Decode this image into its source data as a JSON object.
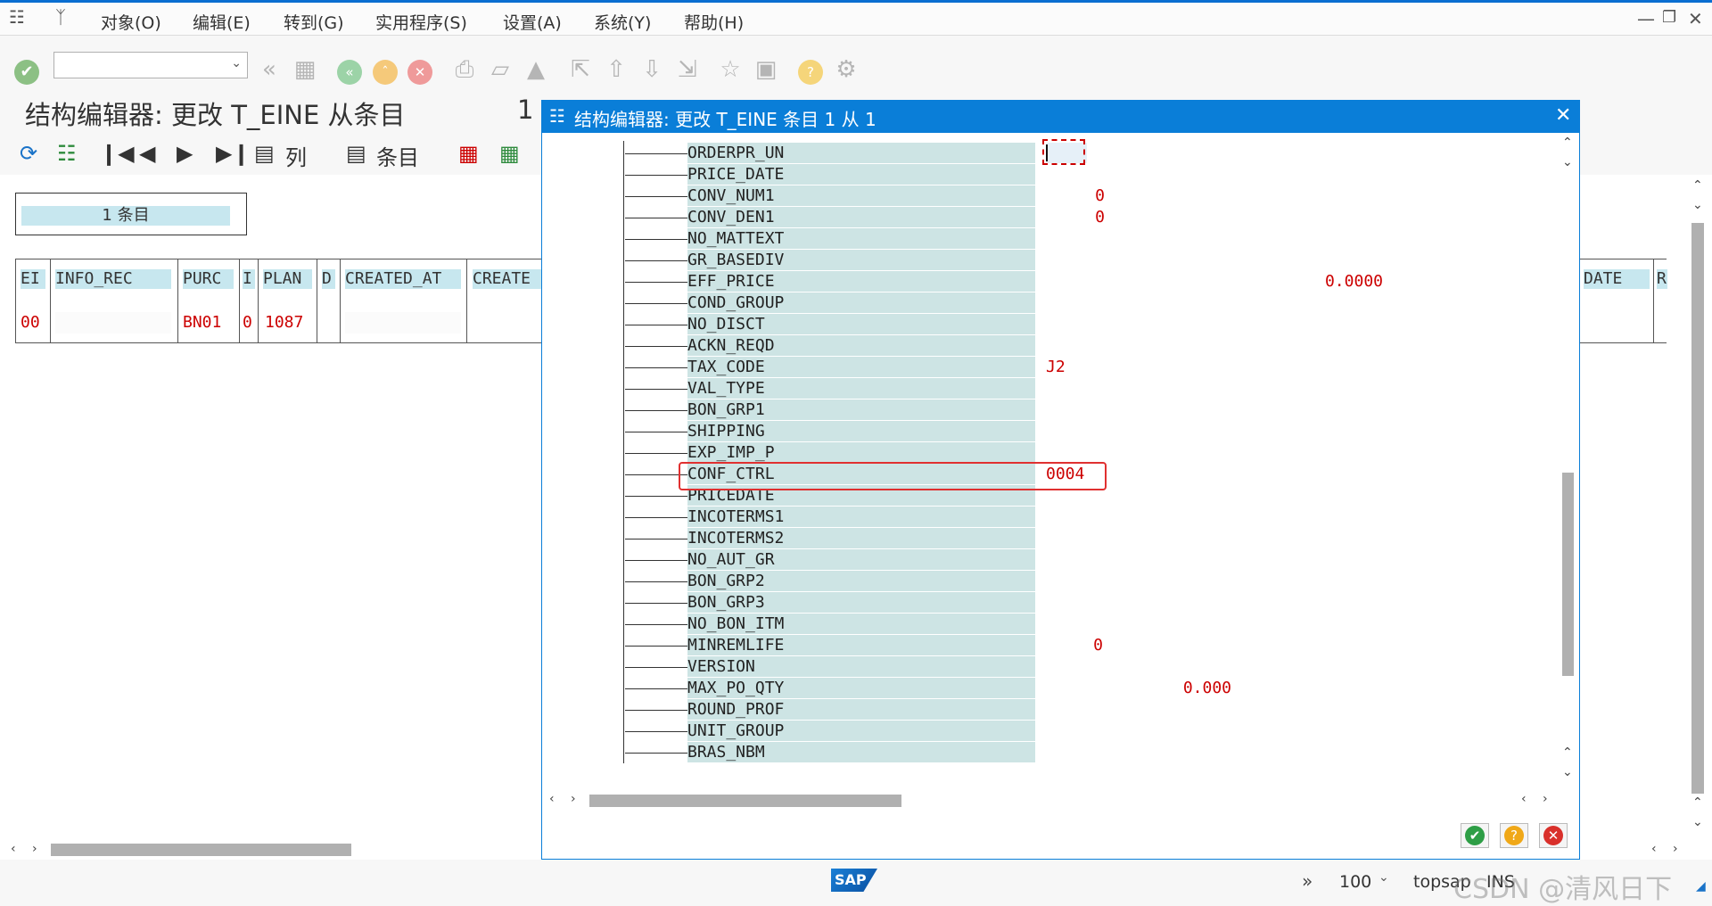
{
  "menu": {
    "items": [
      "对象(O)",
      "编辑(E)",
      "转到(G)",
      "实用程序(S)",
      "设置(A)",
      "系统(Y)",
      "帮助(H)"
    ]
  },
  "window_controls": [
    "minimize-icon",
    "restore-icon",
    "close-icon"
  ],
  "page": {
    "title": "结构编辑器: 更改 T_EINE 从条目",
    "title_count": "1"
  },
  "app_toolbar": {
    "col_label": "列",
    "entry_label": "条目"
  },
  "entry_box": {
    "label": "1  条目"
  },
  "bg_table": {
    "headers": [
      "EI",
      "INFO_REC",
      "PURC",
      "I",
      "PLAN",
      "D",
      "CREATED_AT",
      "CREATE",
      "DATE",
      "R"
    ],
    "row": [
      "00",
      "",
      "BN01",
      "0",
      "1087",
      "",
      "",
      "",
      "",
      ""
    ]
  },
  "dialog": {
    "title": "结构编辑器: 更改 T_EINE 条目 1 从 1",
    "fields": [
      {
        "name": "ORDERPR_UN",
        "value": ""
      },
      {
        "name": "PRICE_DATE",
        "value": ""
      },
      {
        "name": "CONV_NUM1",
        "value": "0"
      },
      {
        "name": "CONV_DEN1",
        "value": "0"
      },
      {
        "name": "NO_MATTEXT",
        "value": ""
      },
      {
        "name": "GR_BASEDIV",
        "value": ""
      },
      {
        "name": "EFF_PRICE",
        "value": "0.0000"
      },
      {
        "name": "COND_GROUP",
        "value": ""
      },
      {
        "name": "NO_DISCT",
        "value": ""
      },
      {
        "name": "ACKN_REQD",
        "value": ""
      },
      {
        "name": "TAX_CODE",
        "value": "J2"
      },
      {
        "name": "VAL_TYPE",
        "value": ""
      },
      {
        "name": "BON_GRP1",
        "value": ""
      },
      {
        "name": "SHIPPING",
        "value": ""
      },
      {
        "name": "EXP_IMP_P",
        "value": ""
      },
      {
        "name": "CONF_CTRL",
        "value": "0004"
      },
      {
        "name": "PRICEDATE",
        "value": ""
      },
      {
        "name": "INCOTERMS1",
        "value": ""
      },
      {
        "name": "INCOTERMS2",
        "value": ""
      },
      {
        "name": "NO_AUT_GR",
        "value": ""
      },
      {
        "name": "BON_GRP2",
        "value": ""
      },
      {
        "name": "BON_GRP3",
        "value": ""
      },
      {
        "name": "NO_BON_ITM",
        "value": ""
      },
      {
        "name": "MINREMLIFE",
        "value": "0"
      },
      {
        "name": "VERSION",
        "value": ""
      },
      {
        "name": "MAX_PO_QTY",
        "value": "0.000"
      },
      {
        "name": "ROUND_PROF",
        "value": ""
      },
      {
        "name": "UNIT_GROUP",
        "value": ""
      },
      {
        "name": "BRAS_NBM",
        "value": ""
      }
    ],
    "highlight_color": "#e03030"
  },
  "status": {
    "zoom": "100",
    "system": "topsap",
    "mode": "INS",
    "watermark": "CSDN @清风日下",
    "logo": "SAP"
  },
  "colors": {
    "accent": "#0a7ed8",
    "field_bg": "#cde4e4",
    "header_bg": "#c7e7ef",
    "value_red": "#cc0000"
  }
}
